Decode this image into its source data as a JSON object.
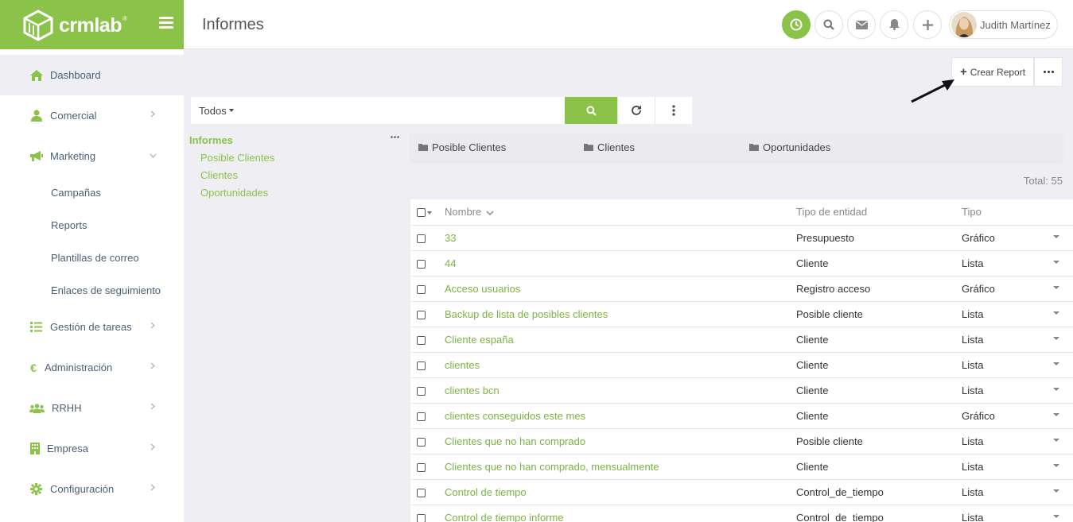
{
  "brand": {
    "name": "crmlab",
    "registered": "®"
  },
  "header": {
    "title": "Informes"
  },
  "user": {
    "name": "Judith Martínez"
  },
  "sidebar": {
    "items": [
      {
        "label": "Dashboard",
        "icon": "home-icon"
      },
      {
        "label": "Comercial",
        "icon": "user-icon"
      },
      {
        "label": "Marketing",
        "icon": "megaphone-icon"
      },
      {
        "label": "Gestión de tareas",
        "icon": "tasks-icon"
      },
      {
        "label": "Administración",
        "icon": "euro-icon"
      },
      {
        "label": "RRHH",
        "icon": "users-icon"
      },
      {
        "label": "Empresa",
        "icon": "building-icon"
      },
      {
        "label": "Configuración",
        "icon": "gear-icon"
      }
    ],
    "marketing_sub": [
      {
        "label": "Campañas"
      },
      {
        "label": "Reports"
      },
      {
        "label": "Plantillas de correo"
      },
      {
        "label": "Enlaces de seguimiento"
      }
    ]
  },
  "actions": {
    "crear_label": "Crear Report"
  },
  "search": {
    "filter_label": "Todos",
    "value": "",
    "placeholder": ""
  },
  "tree": {
    "root": "Informes",
    "children": [
      "Posible Clientes",
      "Clientes",
      "Oportunidades"
    ]
  },
  "folders": [
    "Posible Clientes",
    "Clientes",
    "Oportunidades"
  ],
  "total": "Total: 55",
  "table": {
    "columns": {
      "name": "Nombre",
      "entity": "Tipo de entidad",
      "type": "Tipo"
    },
    "rows": [
      {
        "name": "33",
        "entity": "Presupuesto",
        "type": "Gráfico"
      },
      {
        "name": "44",
        "entity": "Cliente",
        "type": "Lista"
      },
      {
        "name": "Acceso usuarios",
        "entity": "Registro acceso",
        "type": "Gráfico"
      },
      {
        "name": "Backup de lista de posibles clientes",
        "entity": "Posible cliente",
        "type": "Lista"
      },
      {
        "name": "Cliente españa",
        "entity": "Cliente",
        "type": "Lista"
      },
      {
        "name": "clientes",
        "entity": "Cliente",
        "type": "Lista"
      },
      {
        "name": "clientes bcn",
        "entity": "Cliente",
        "type": "Lista"
      },
      {
        "name": "clientes conseguidos este mes",
        "entity": "Cliente",
        "type": "Gráfico"
      },
      {
        "name": "Clientes que no han comprado",
        "entity": "Posible cliente",
        "type": "Lista"
      },
      {
        "name": "Clientes que no han comprado, mensualmente",
        "entity": "Cliente",
        "type": "Lista"
      },
      {
        "name": "Control de tiempo",
        "entity": "Control_de_tiempo",
        "type": "Lista"
      },
      {
        "name": "Control de tiempo informe",
        "entity": "Control_de_tiempo",
        "type": "Lista"
      }
    ]
  },
  "colors": {
    "accent": "#8bc34a",
    "link": "#7cb342",
    "nav_text": "#4a5f74",
    "background": "#eeeef3"
  }
}
